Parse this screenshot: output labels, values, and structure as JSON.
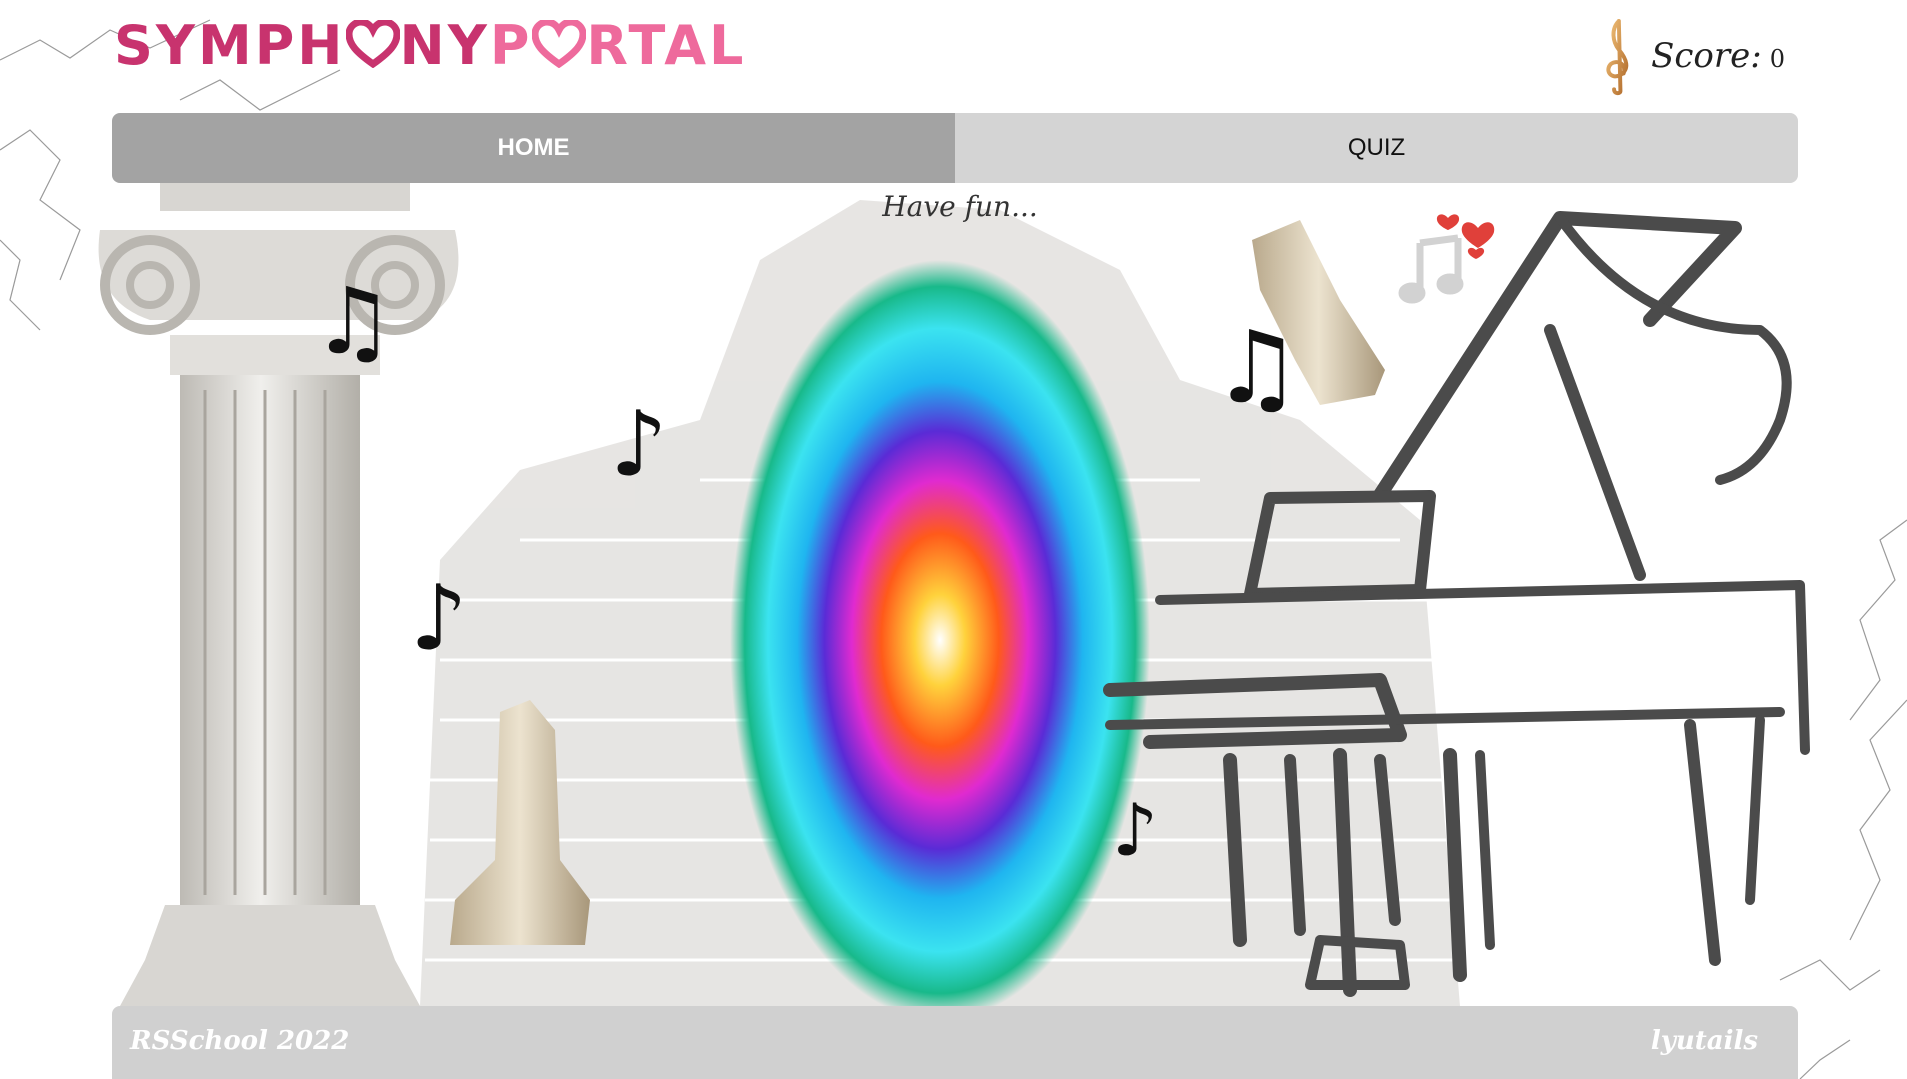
{
  "header": {
    "logo_part1_a": "SYMPH",
    "logo_part1_b": "NY",
    "logo_part2_a": "P",
    "logo_part2_b": "RTAL",
    "score_label": "Score:",
    "score_value": "0"
  },
  "nav": {
    "tabs": [
      {
        "label": "HOME",
        "active": true
      },
      {
        "label": "QUIZ",
        "active": false
      }
    ]
  },
  "main": {
    "tagline": "Have fun..."
  },
  "footer": {
    "left_text": "RSSchool 2022",
    "right_text": "lyutails"
  },
  "colors": {
    "logo_dark_pink": "#c8336e",
    "logo_light_pink": "#ee6a9c",
    "nav_active": "#a3a3a3",
    "nav_inactive": "#d4d4d4",
    "footer_bg": "#d0d0d0"
  },
  "icons": {
    "logo_heart": "heart-icon",
    "score": "treble-clef-icon",
    "notes": [
      "beamed-notes-icon",
      "eighth-note-icon",
      "eighth-note-icon",
      "beamed-notes-icon",
      "eighth-note-icon"
    ]
  }
}
